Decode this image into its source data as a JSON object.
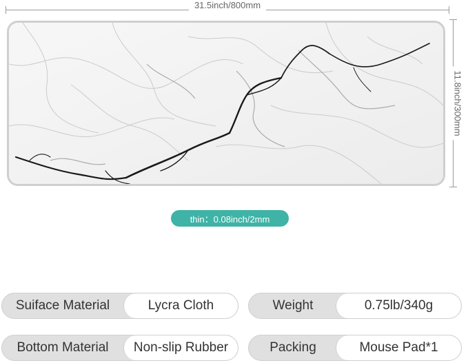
{
  "dimensions": {
    "width_label": "31.5inch/800mm",
    "height_label": "11.8inch/300mm"
  },
  "thickness_label": "thin：0.08inch/2mm",
  "specs": [
    {
      "key": "Suiface Material",
      "value": "Lycra Cloth"
    },
    {
      "key": "Weight",
      "value": "0.75lb/340g"
    },
    {
      "key": "Bottom Material",
      "value": "Non-slip Rubber"
    },
    {
      "key": "Packing",
      "value": "Mouse Pad*1"
    }
  ],
  "colors": {
    "accent": "#3eb3a6",
    "pill_key_bg": "#e0e0e0",
    "pill_value_bg": "#ffffff",
    "marble_bg": "#f4f4f4",
    "vein_dark": "#1a1a1a"
  }
}
